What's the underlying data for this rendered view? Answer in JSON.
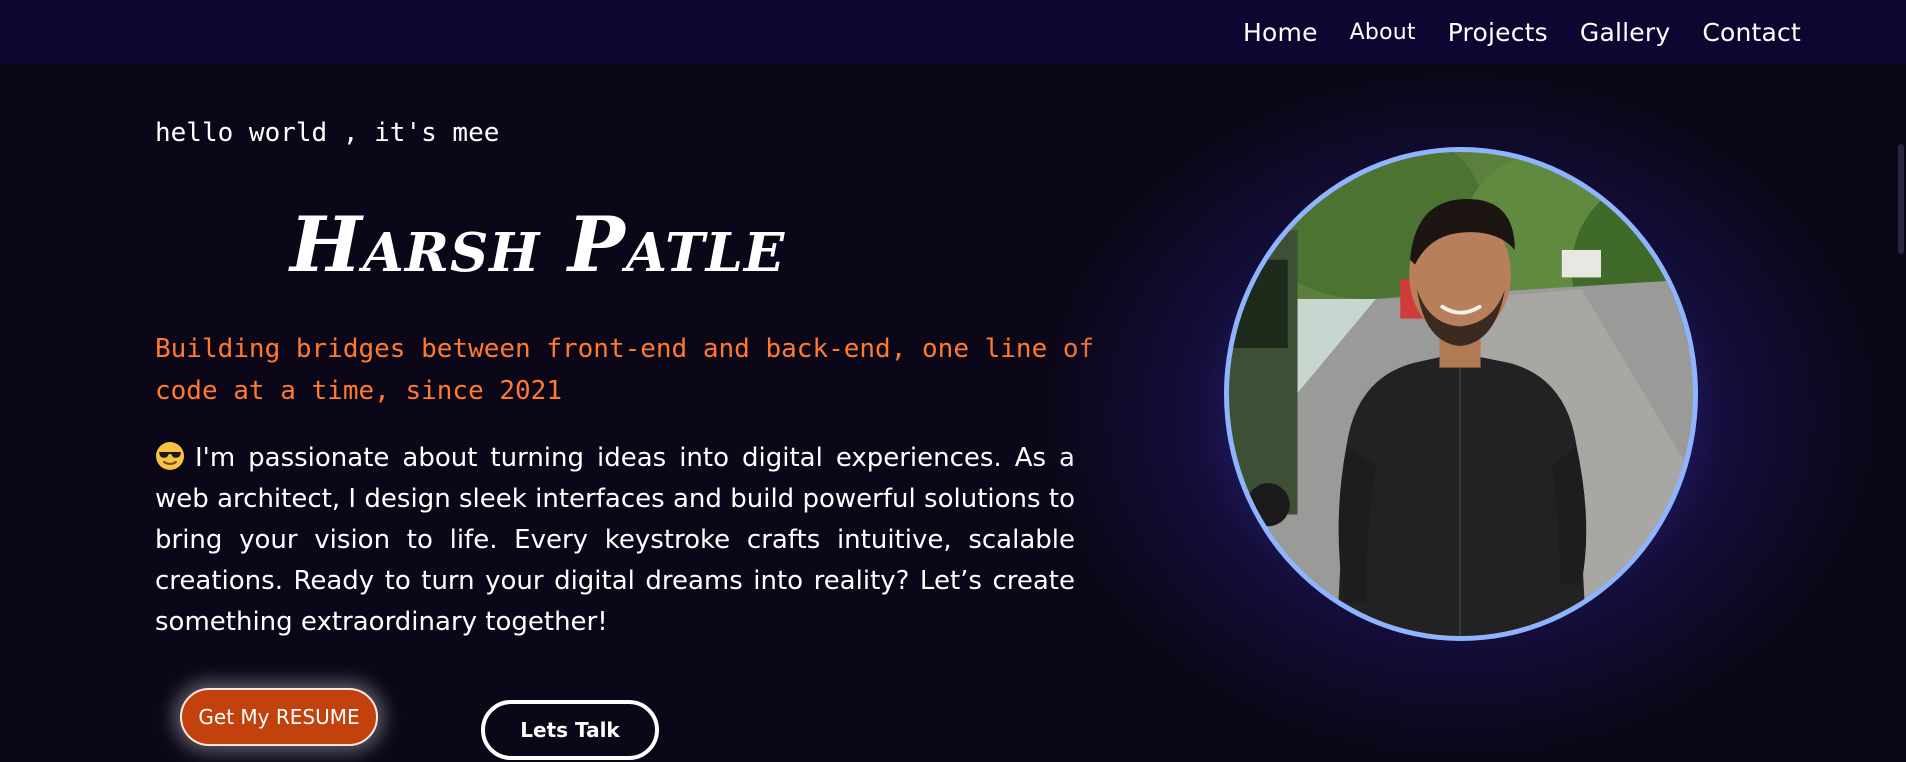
{
  "nav": {
    "items": [
      {
        "label": "Home"
      },
      {
        "label": "About"
      },
      {
        "label": "Projects"
      },
      {
        "label": "Gallery"
      },
      {
        "label": "Contact"
      }
    ]
  },
  "hero": {
    "greeting": "hello world , it's mee",
    "name": "Harsh Patle",
    "tagline": "Building bridges between front-end and back-end, one line of code at a time, since 2021",
    "bio_emoji": "smiling-face-with-sunglasses-icon",
    "bio": "I'm passionate about turning ideas into digital experiences. As a web architect, I design sleek interfaces and build powerful solutions to bring your vision to life. Every keystroke crafts intuitive, scalable creations. Ready to turn your digital dreams into reality? Let’s create something extraordinary together!",
    "resume_button": "Get My RESUME",
    "talk_button": "Lets Talk",
    "portrait": "profile-photo"
  },
  "colors": {
    "background": "#0b0718",
    "navbar": "#0d0630",
    "accent_orange": "#ff7a2e",
    "button_orange": "#c2410c",
    "portrait_ring": "#8fb4ff",
    "glow": "#5046dc"
  }
}
